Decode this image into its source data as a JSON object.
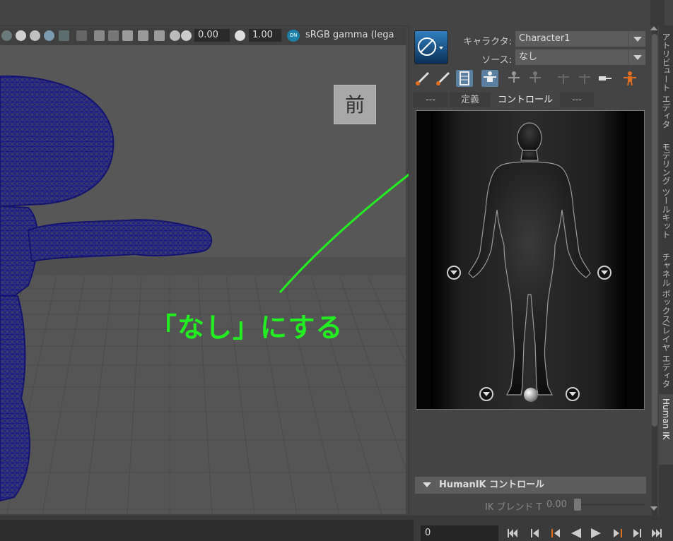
{
  "viewport": {
    "toolbar": {
      "field_a": "0.00",
      "field_b": "1.00",
      "cm_badge": "ON",
      "color_space": "sRGB gamma (lega"
    },
    "view_label": "前",
    "annotation": "「なし」にする"
  },
  "hik": {
    "character_label": "キャラクタ:",
    "character_value": "Character1",
    "source_label": "ソース:",
    "source_value": "なし",
    "tabs": [
      "---",
      "定義",
      "コントロール",
      "---"
    ],
    "section_title": "HumanIK コントロール",
    "ik_blend_label": "IK ブレンド T",
    "ik_blend_value": "0.00"
  },
  "side_tabs": [
    "アトリビュート エディタ",
    "モデリング ツールキット",
    "チャネル ボックス/レイヤ エディタ",
    "Human IK"
  ],
  "timeline": {
    "frame": "0"
  },
  "colors": {
    "annotation": "#22ee22",
    "wireframe": "#1a1a8c",
    "accent": "#5a7fa0",
    "marker": "#e07020"
  },
  "icons": [
    "hik-logo-icon",
    "left-arm-effector-icon",
    "right-arm-effector-icon",
    "ribcage-icon",
    "fullbody-icon",
    "pose-icon",
    "pin-icon",
    "orange-figure-icon"
  ]
}
